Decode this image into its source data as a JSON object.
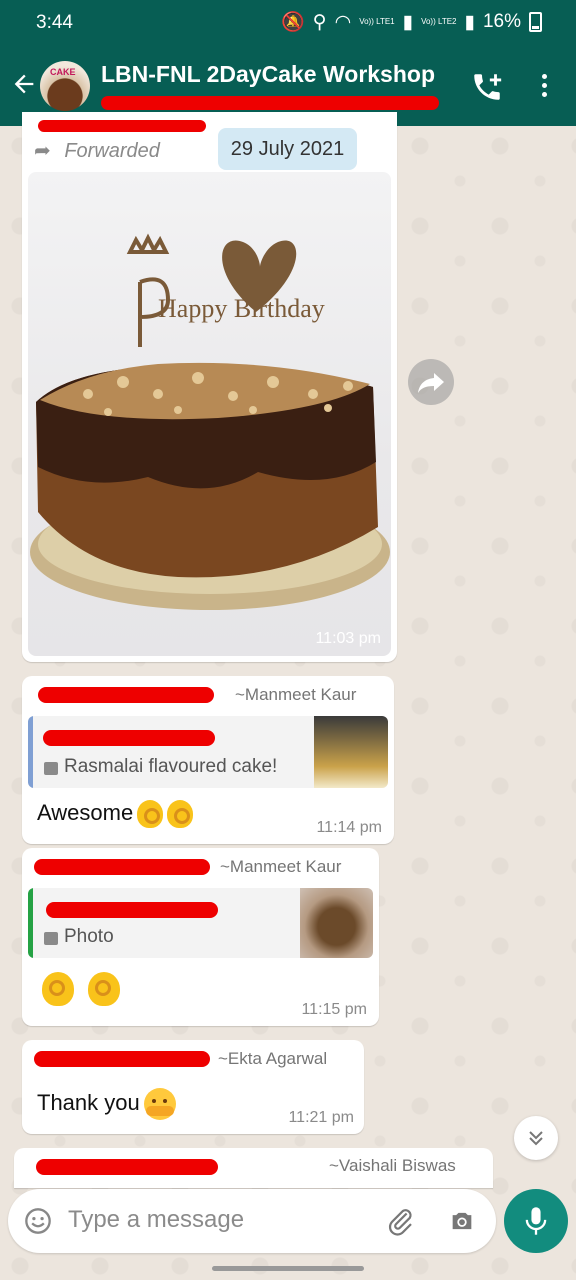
{
  "status_bar": {
    "time": "3:44",
    "sim1_label": "Vo)) LTE1",
    "sim2_label": "Vo)) LTE2",
    "battery": "16%"
  },
  "header": {
    "title": "LBN-FNL 2DayCake Workshop",
    "avatar_text": "CAKE"
  },
  "chat": {
    "forwarded_label": "Forwarded",
    "date_chip": "29 July 2021",
    "messages": [
      {
        "type": "image",
        "photo_topper": "Happy Birthday",
        "time": "11:03 pm"
      },
      {
        "sender": "~Manmeet Kaur",
        "quote_text": "Rasmalai flavoured cake!",
        "text": "Awesome",
        "time": "11:14 pm"
      },
      {
        "sender": "~Manmeet Kaur",
        "quote_text": "Photo",
        "text": "",
        "time": "11:15 pm"
      },
      {
        "sender": "~Ekta Agarwal",
        "text": "Thank you",
        "time": "11:21 pm"
      },
      {
        "sender": "~Vaishali Biswas"
      }
    ]
  },
  "input": {
    "placeholder": "Type a message"
  },
  "colors": {
    "header": "#075e54",
    "mic": "#128c7e",
    "wallpaper": "#ece5dd",
    "redaction": "#e00000"
  }
}
